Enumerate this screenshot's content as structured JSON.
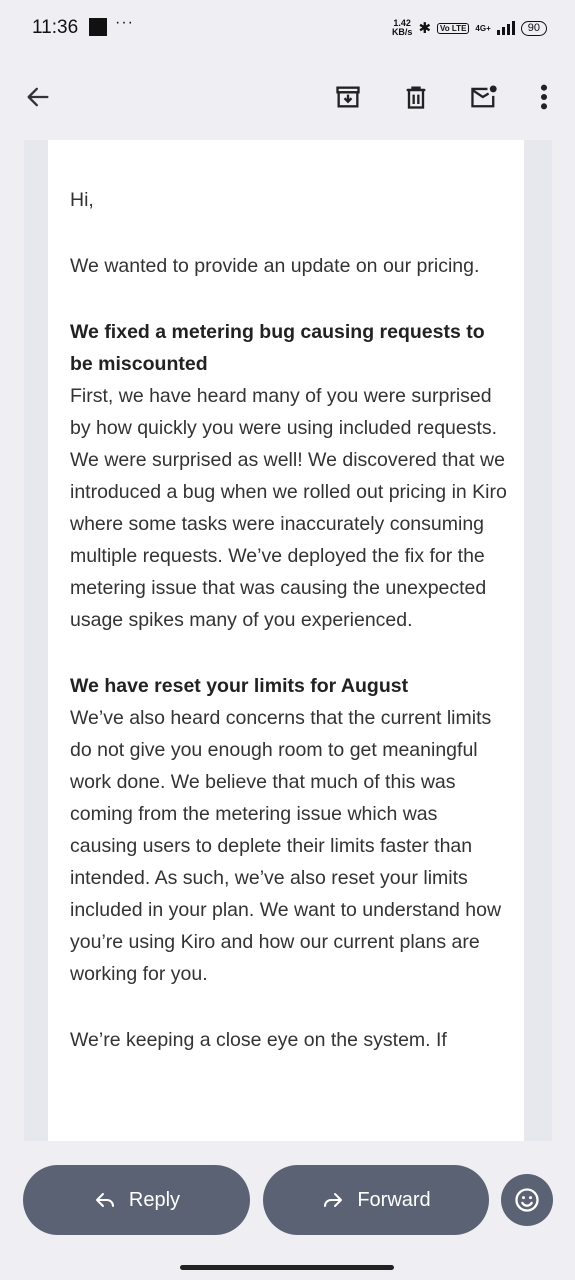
{
  "status_bar": {
    "time": "11:36",
    "more_dots": "···",
    "net_speed_value": "1.42",
    "net_speed_unit": "KB/s",
    "volte": "Vo LTE",
    "network": "4G+",
    "battery": "90"
  },
  "toolbar": {
    "icons": [
      "back-arrow-icon",
      "archive-icon",
      "delete-icon",
      "mark-unread-icon",
      "more-vert-icon"
    ]
  },
  "email": {
    "greeting": "Hi,",
    "intro": "We wanted to provide an update on our pricing.",
    "section1_heading": "We fixed a metering bug causing requests to be miscounted",
    "section1_body": "First, we have heard many of you were surprised by how quickly you were using included requests. We were surprised as well! We discovered that we introduced a bug when we rolled out pricing in Kiro where some tasks were inaccurately consuming multiple requests. We’ve deployed the fix for the metering issue that was causing the unexpected usage spikes many of you experienced.",
    "section2_heading": "We have reset your limits for August",
    "section2_body": "We’ve also heard concerns that the current limits do not give you enough room to get meaningful work done. We believe that much of this was coming from the metering issue which was causing users to deplete their limits faster than intended. As such, we’ve also reset your limits included in your plan. We want to understand how you’re using Kiro and how our current plans are working for you.",
    "closing_partial": "We’re keeping a close eye on the system. If"
  },
  "actions": {
    "reply_label": "Reply",
    "forward_label": "Forward"
  },
  "colors": {
    "background": "#eeeef3",
    "button": "#5a6273",
    "card": "#ffffff"
  }
}
